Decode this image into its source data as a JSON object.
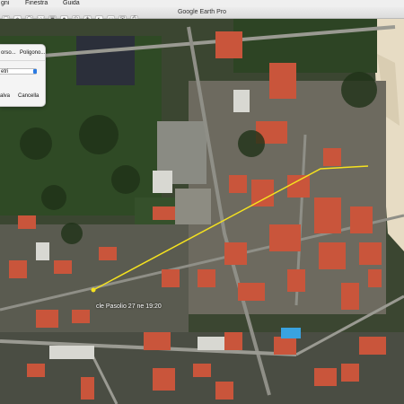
{
  "menubar": {
    "item_left": "gni",
    "item_window": "Finestra",
    "item_help": "Guida"
  },
  "window": {
    "title": "Google Earth Pro"
  },
  "dialog": {
    "tab_line": "orso...",
    "tab_polygon": "Poligono...",
    "unit_value": "etri",
    "save_label": "alva",
    "cancel_label": "Cancella"
  },
  "measure_label": "cle Pasolio 27 ne 19:20",
  "colors": {
    "measure_line": "#f5e21f",
    "roof": "#c9553b",
    "vegetation": "#2f4a25",
    "beach": "#e7dcc4"
  }
}
